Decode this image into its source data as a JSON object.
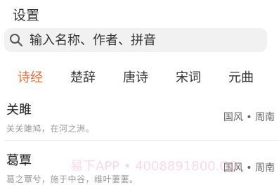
{
  "header": {
    "title": "设置"
  },
  "search": {
    "placeholder": "输入名称、作者、拼音"
  },
  "tabs": [
    {
      "label": "诗经",
      "active": true
    },
    {
      "label": "楚辞",
      "active": false
    },
    {
      "label": "唐诗",
      "active": false
    },
    {
      "label": "宋词",
      "active": false
    },
    {
      "label": "元曲",
      "active": false
    }
  ],
  "items": [
    {
      "title": "关雎",
      "excerpt": "关关雎鸠，在河之洲。",
      "meta": "国风 • 周南"
    },
    {
      "title": "葛覃",
      "excerpt": "葛之覃兮，施于中谷，维叶萋萋。",
      "meta": "国风 • 周南"
    }
  ],
  "watermark": "易下APP • 4008891800.CO",
  "colors": {
    "accent": "#e8713d",
    "search_bg": "#f1f1f1"
  }
}
